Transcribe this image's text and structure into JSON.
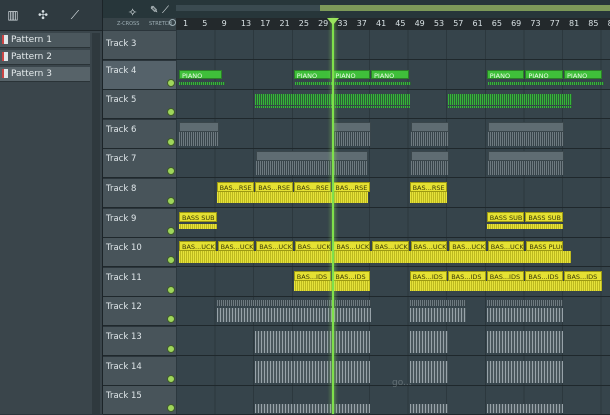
{
  "toolbar": {
    "icons": [
      "piano-icon",
      "step-icon",
      "link-icon"
    ]
  },
  "patterns": [
    {
      "label": "Pattern 1",
      "selected": false
    },
    {
      "label": "Pattern 2",
      "selected": false
    },
    {
      "label": "Pattern 3",
      "selected": true
    }
  ],
  "header": {
    "tool_a": "Z-CROSS",
    "tool_b": "STRETCH"
  },
  "ruler": [
    "1",
    "5",
    "9",
    "13",
    "17",
    "21",
    "25",
    "29",
    "33",
    "37",
    "41",
    "45",
    "49",
    "53",
    "57",
    "61",
    "65",
    "69",
    "73",
    "77",
    "81",
    "85",
    "89"
  ],
  "tracks": [
    {
      "name": "Track 3"
    },
    {
      "name": "Track 4"
    },
    {
      "name": "Track 5"
    },
    {
      "name": "Track 6"
    },
    {
      "name": "Track 7"
    },
    {
      "name": "Track 8"
    },
    {
      "name": "Track 9"
    },
    {
      "name": "Track 10"
    },
    {
      "name": "Track 11"
    },
    {
      "name": "Track 12"
    },
    {
      "name": "Track 13"
    },
    {
      "name": "Track 14"
    },
    {
      "name": "Track 15"
    }
  ],
  "clip_labels": {
    "piano": "PIANO",
    "bas_rse": "BAS...RSE",
    "bass_sub": "BASS SUB",
    "bas_uck": "BAS...UCK",
    "bass_pluck": "BASS PLUCK",
    "bas_ids": "BAS...IDS"
  },
  "colors": {
    "green": "#3fbf3a",
    "yellow": "#e5e133",
    "playhead": "#7fe04b"
  },
  "watermark": "go..."
}
